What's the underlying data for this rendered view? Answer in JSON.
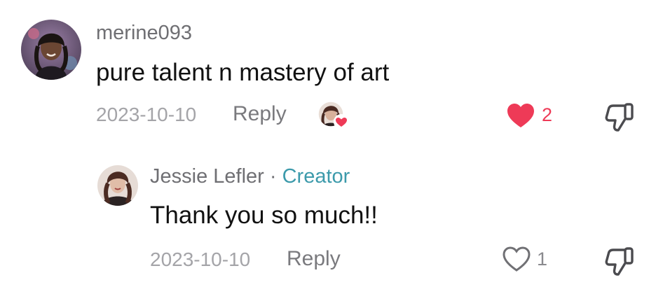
{
  "comment": {
    "username": "merine093",
    "text": "pure talent n mastery of art",
    "date": "2023-10-10",
    "reply_label": "Reply",
    "like_count": "2",
    "liked": true,
    "liked_by_creator": true
  },
  "reply": {
    "username": "Jessie Lefler",
    "separator": "·",
    "badge": "Creator",
    "text": "Thank you so much!!",
    "date": "2023-10-10",
    "reply_label": "Reply",
    "like_count": "1",
    "liked": false
  },
  "colors": {
    "like_active": "#ee3a57",
    "creator": "#3c9aab",
    "muted": "#a4a4a8"
  },
  "icons": {
    "like": "heart-icon",
    "dislike": "thumbs-down-icon",
    "creator_like": "creator-liked-badge-icon"
  }
}
